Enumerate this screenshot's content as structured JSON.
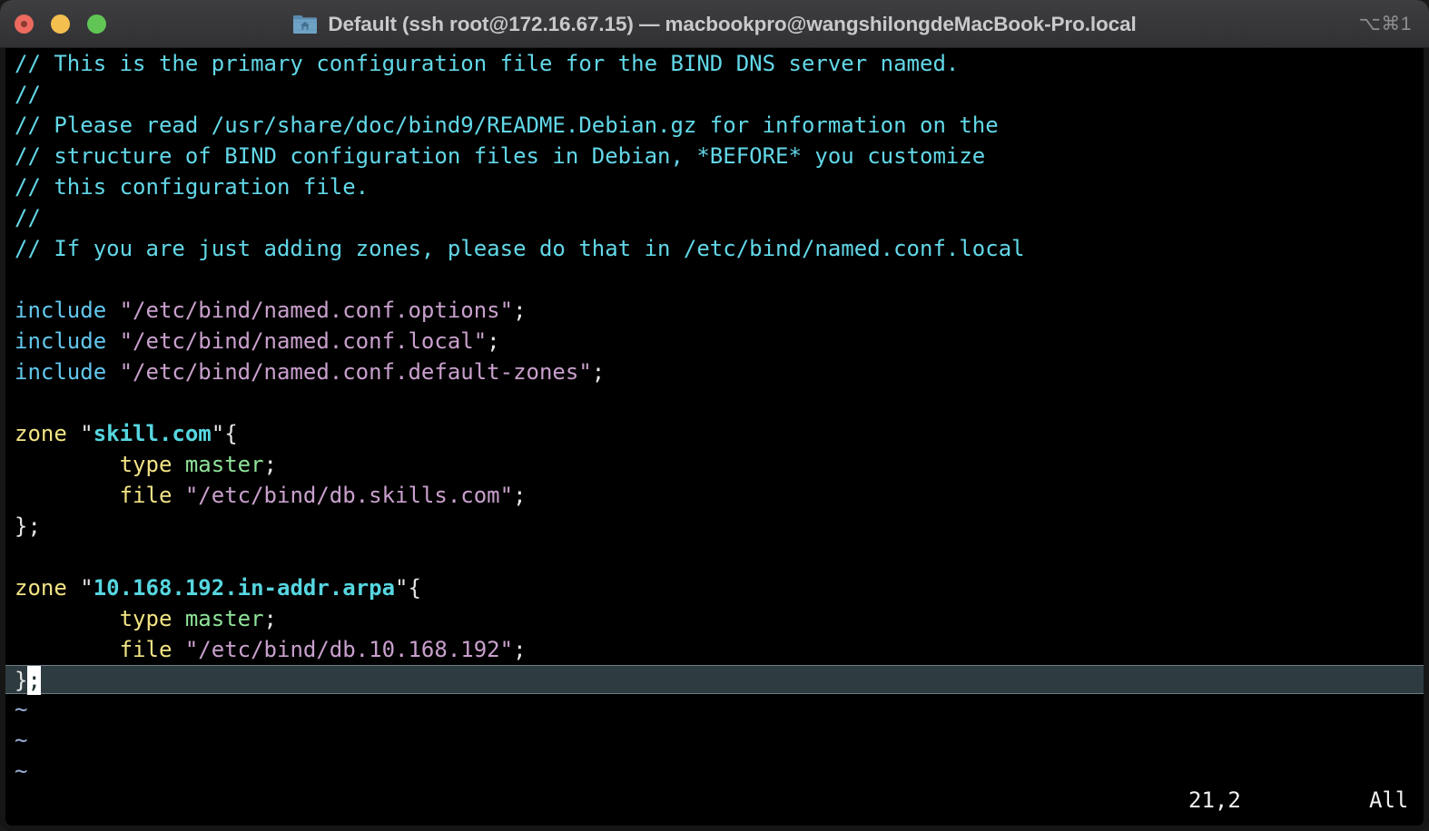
{
  "window": {
    "title": "Default (ssh root@172.16.67.15) — macbookpro@wangshilongdeMacBook-Pro.local",
    "shortcut": "⌥⌘1",
    "icon": "home-folder-icon",
    "traffic_lights": {
      "close_label": "Close",
      "minimize_label": "Minimize",
      "maximize_label": "Maximize",
      "close_color": "#ec6a5f",
      "minimize_color": "#f3bf4f",
      "maximize_color": "#61c555"
    },
    "titlebar_color": "#37373a",
    "background_color": "#000000"
  },
  "editor": {
    "lines": [
      {
        "segments": [
          {
            "t": "// This is the primary configuration file for the BIND DNS server named.",
            "c": "c-comment"
          }
        ]
      },
      {
        "segments": [
          {
            "t": "//",
            "c": "c-comment"
          }
        ]
      },
      {
        "segments": [
          {
            "t": "// Please read /usr/share/doc/bind9/README.Debian.gz for information on the",
            "c": "c-comment"
          }
        ]
      },
      {
        "segments": [
          {
            "t": "// structure of BIND configuration files in Debian, *BEFORE* you customize",
            "c": "c-comment"
          }
        ]
      },
      {
        "segments": [
          {
            "t": "// this configuration file.",
            "c": "c-comment"
          }
        ]
      },
      {
        "segments": [
          {
            "t": "//",
            "c": "c-comment"
          }
        ]
      },
      {
        "segments": [
          {
            "t": "// If you are just adding zones, please do that in /etc/bind/named.conf.local",
            "c": "c-comment"
          }
        ]
      },
      {
        "segments": [
          {
            "t": "",
            "c": "c-punct"
          }
        ]
      },
      {
        "segments": [
          {
            "t": "include ",
            "c": "c-keyword"
          },
          {
            "t": "\"/etc/bind/named.conf.options\"",
            "c": "c-string"
          },
          {
            "t": ";",
            "c": "c-punct"
          }
        ]
      },
      {
        "segments": [
          {
            "t": "include ",
            "c": "c-keyword"
          },
          {
            "t": "\"/etc/bind/named.conf.local\"",
            "c": "c-string"
          },
          {
            "t": ";",
            "c": "c-punct"
          }
        ]
      },
      {
        "segments": [
          {
            "t": "include ",
            "c": "c-keyword"
          },
          {
            "t": "\"/etc/bind/named.conf.default-zones\"",
            "c": "c-string"
          },
          {
            "t": ";",
            "c": "c-punct"
          }
        ]
      },
      {
        "segments": [
          {
            "t": "",
            "c": "c-punct"
          }
        ]
      },
      {
        "segments": [
          {
            "t": "zone ",
            "c": "c-type"
          },
          {
            "t": "\"",
            "c": "c-punct"
          },
          {
            "t": "skill.com",
            "c": "c-zone"
          },
          {
            "t": "\"{",
            "c": "c-punct"
          }
        ]
      },
      {
        "segments": [
          {
            "t": "        type ",
            "c": "c-type"
          },
          {
            "t": "master",
            "c": "c-value"
          },
          {
            "t": ";",
            "c": "c-punct"
          }
        ]
      },
      {
        "segments": [
          {
            "t": "        file ",
            "c": "c-type"
          },
          {
            "t": "\"/etc/bind/db.skills.com\"",
            "c": "c-string"
          },
          {
            "t": ";",
            "c": "c-punct"
          }
        ]
      },
      {
        "segments": [
          {
            "t": "};",
            "c": "c-punct"
          }
        ]
      },
      {
        "segments": [
          {
            "t": "",
            "c": "c-punct"
          }
        ]
      },
      {
        "segments": [
          {
            "t": "zone ",
            "c": "c-type"
          },
          {
            "t": "\"",
            "c": "c-punct"
          },
          {
            "t": "10.168.192.in-addr.arpa",
            "c": "c-zone"
          },
          {
            "t": "\"{",
            "c": "c-punct"
          }
        ]
      },
      {
        "segments": [
          {
            "t": "        type ",
            "c": "c-type"
          },
          {
            "t": "master",
            "c": "c-value"
          },
          {
            "t": ";",
            "c": "c-punct"
          }
        ]
      },
      {
        "segments": [
          {
            "t": "        file ",
            "c": "c-type"
          },
          {
            "t": "\"/etc/bind/db.10.168.192\"",
            "c": "c-string"
          },
          {
            "t": ";",
            "c": "c-punct"
          }
        ]
      },
      {
        "cursorline": true,
        "segments": [
          {
            "t": "}",
            "c": "c-punct"
          },
          {
            "t": ";",
            "c": "cursor-block"
          }
        ]
      },
      {
        "segments": [
          {
            "t": "~",
            "c": "c-tilde"
          }
        ]
      },
      {
        "segments": [
          {
            "t": "~",
            "c": "c-tilde"
          }
        ]
      },
      {
        "segments": [
          {
            "t": "~",
            "c": "c-tilde"
          }
        ]
      }
    ],
    "colors": {
      "comment": "#62d8e8",
      "keyword": "#63c7ee",
      "string": "#c9a0cd",
      "type": "#f2e384",
      "value": "#8fe39a",
      "zone_name": "#56d6e0",
      "tilde": "#9ab0d8",
      "cursorline_bg": "#2e3b41",
      "cursor_bg": "#ffffff"
    }
  },
  "status": {
    "position": "21,2",
    "scroll": "All"
  }
}
